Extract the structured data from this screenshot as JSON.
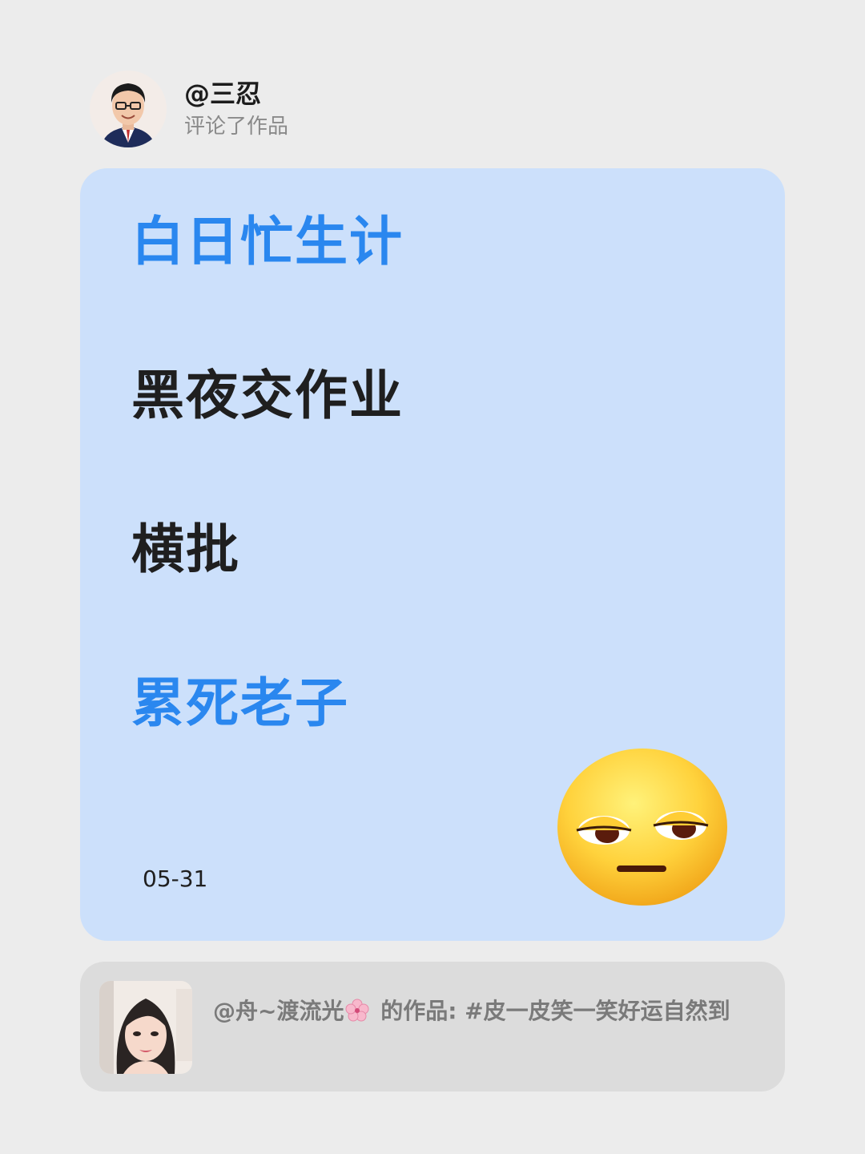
{
  "header": {
    "username": "@三忍",
    "action": "评论了作品",
    "avatar_icon": "avatar-man-glasses-suit"
  },
  "card": {
    "lines": [
      {
        "text": "白日忙生计",
        "color": "#2a87ef"
      },
      {
        "text": "黑夜交作业",
        "color": "#1f1f1f"
      },
      {
        "text": "横批",
        "color": "#1f1f1f"
      },
      {
        "text": "累死老子",
        "color": "#2a87ef"
      }
    ],
    "date": "05-31",
    "emoji_icon": "unamused-face-emoji",
    "background": "#cce0fb"
  },
  "quote": {
    "user": "@舟~渡流光",
    "user_icon": "cherry-blossom-icon",
    "text_line": "的作品: #皮一皮笑一笑好运自然到",
    "avatar_icon": "avatar-woman-portrait"
  }
}
